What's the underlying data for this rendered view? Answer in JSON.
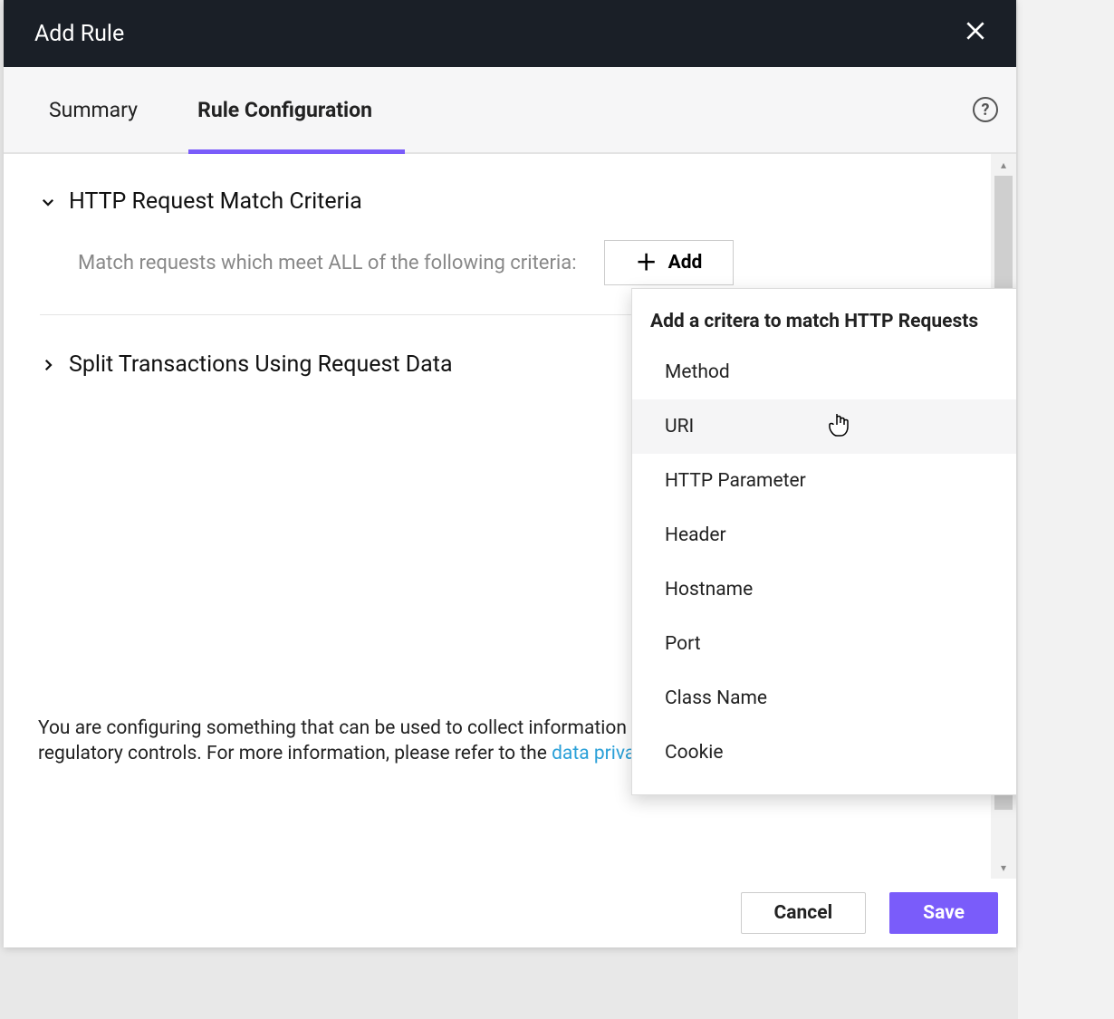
{
  "modal": {
    "title": "Add Rule"
  },
  "tabs": {
    "summary": "Summary",
    "rule_config": "Rule Configuration"
  },
  "sections": {
    "match_criteria": {
      "title": "HTTP Request Match Criteria",
      "subtitle": "Match requests which meet ALL of the following criteria:",
      "add_label": "Add"
    },
    "split_tx": {
      "title": "Split Transactions Using Request Data"
    }
  },
  "dropdown": {
    "title": "Add a critera to match HTTP Requests",
    "items": {
      "method": "Method",
      "uri": "URI",
      "http_param": "HTTP Parameter",
      "header": "Header",
      "hostname": "Hostname",
      "port": "Port",
      "class_name": "Class Name",
      "cookie": "Cookie"
    }
  },
  "footer_note": {
    "text_before": "You are configuring something that can be used to collect information that may be subject to legal or regulatory controls. For more information, please refer to the ",
    "link_text": "data privacy policy"
  },
  "buttons": {
    "cancel": "Cancel",
    "save": "Save"
  }
}
